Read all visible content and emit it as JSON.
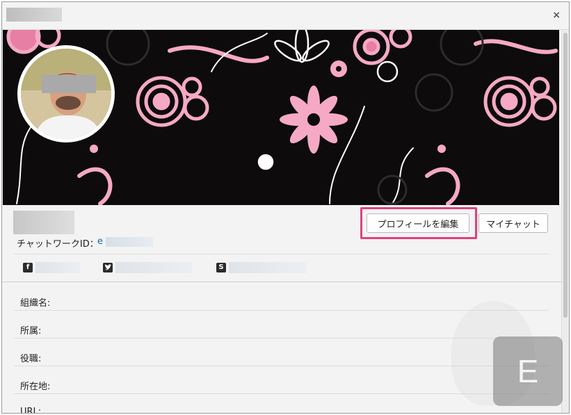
{
  "window": {
    "close_glyph": "×",
    "title_redacted": true
  },
  "banner": {
    "background_color": "#0d0b0c",
    "accent_color": "#f5a9c4",
    "pattern": "pink-and-white-floral-swirls"
  },
  "profile": {
    "chatwork_id_label": "チャットワークID：",
    "chatwork_id_value": "e"
  },
  "buttons": {
    "edit_profile": "プロフィールを編集",
    "my_chat": "マイチャット",
    "highlight_color": "#e0417f"
  },
  "social": [
    {
      "icon": "facebook-icon",
      "glyph": "f"
    },
    {
      "icon": "twitter-icon",
      "glyph": "🐦"
    },
    {
      "icon": "skype-icon",
      "glyph": "S"
    }
  ],
  "fields": [
    {
      "label": "組織名:"
    },
    {
      "label": "所属:"
    },
    {
      "label": "役職:"
    },
    {
      "label": "所在地:"
    },
    {
      "label": "URL:"
    }
  ],
  "watermark": {
    "letter": "E"
  }
}
